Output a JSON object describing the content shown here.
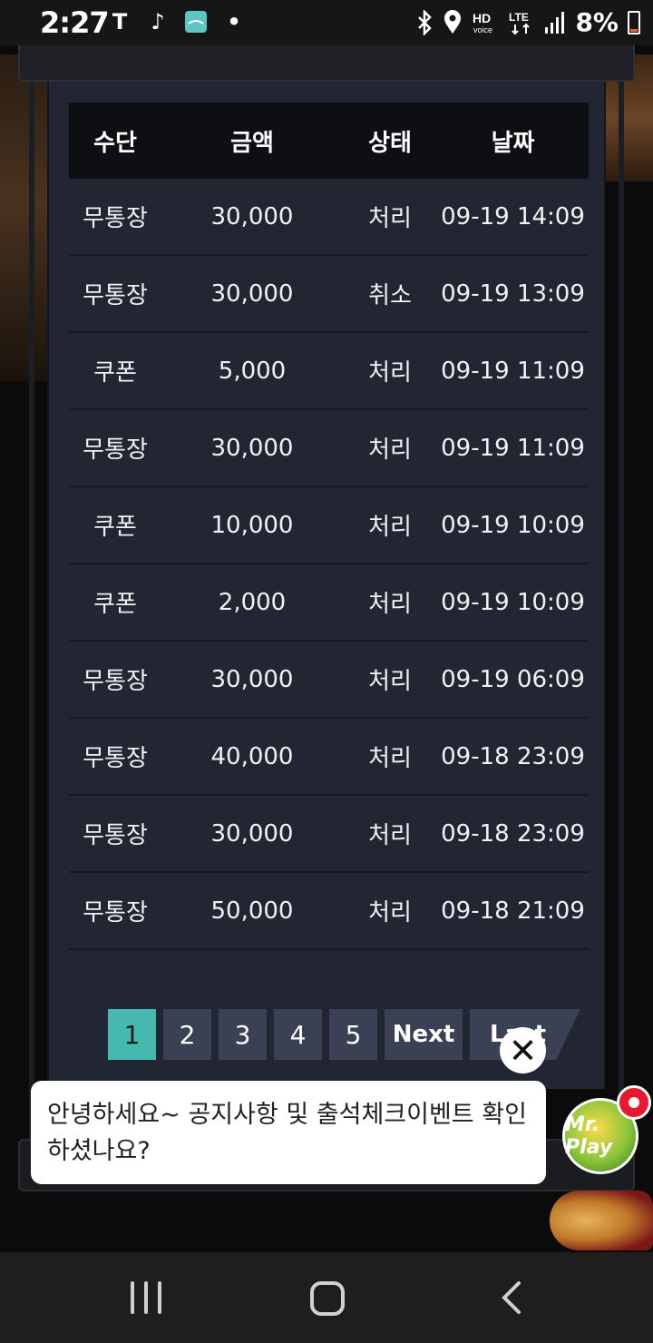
{
  "status_bar": {
    "time": "2:27",
    "battery": "8%",
    "icons": [
      "t-mobile-icon",
      "tiktok-icon",
      "app-icon",
      "bluetooth-icon",
      "location-icon",
      "hd-voice-icon",
      "lte-icon",
      "signal-icon",
      "battery-icon"
    ]
  },
  "table": {
    "headers": [
      "수단",
      "금액",
      "상태",
      "날짜"
    ],
    "rows": [
      [
        "무통장",
        "30,000",
        "처리",
        "09-19 14:09"
      ],
      [
        "무통장",
        "30,000",
        "취소",
        "09-19 13:09"
      ],
      [
        "쿠폰",
        "5,000",
        "처리",
        "09-19 11:09"
      ],
      [
        "무통장",
        "30,000",
        "처리",
        "09-19 11:09"
      ],
      [
        "쿠폰",
        "10,000",
        "처리",
        "09-19 10:09"
      ],
      [
        "쿠폰",
        "2,000",
        "처리",
        "09-19 10:09"
      ],
      [
        "무통장",
        "30,000",
        "처리",
        "09-19 06:09"
      ],
      [
        "무통장",
        "40,000",
        "처리",
        "09-18 23:09"
      ],
      [
        "무통장",
        "30,000",
        "처리",
        "09-18 23:09"
      ],
      [
        "무통장",
        "50,000",
        "처리",
        "09-18 21:09"
      ]
    ]
  },
  "pagination": {
    "pages": [
      "1",
      "2",
      "3",
      "4",
      "5"
    ],
    "current": "1",
    "next_label": "Next",
    "last_label": "Last"
  },
  "chat": {
    "message": "안녕하세요~ 공지사항 및 출석체크이벤트 확인 하셨나요?",
    "close_symbol": "✕"
  },
  "mascot": {
    "label": "Mr. Play"
  },
  "colors": {
    "panel_bg": "#222633",
    "header_bg": "#0e0f12",
    "page_active": "#45b8b0",
    "page_default": "#3a4155",
    "notification": "#e8192c"
  }
}
